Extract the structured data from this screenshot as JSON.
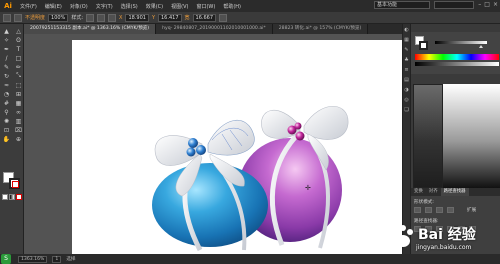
{
  "app": {
    "logo": "Ai"
  },
  "menu": {
    "items": [
      "文件(F)",
      "编辑(E)",
      "对象(O)",
      "文字(T)",
      "选择(S)",
      "效果(C)",
      "视图(V)",
      "窗口(W)",
      "帮助(H)"
    ]
  },
  "workspace": {
    "label": "基本功能"
  },
  "control": {
    "selection_label": "不透明度",
    "opacity_value": "100%",
    "style_label": "样式:",
    "x_label": "X",
    "x_value": "18.901",
    "y_label": "Y",
    "y_value": "16.417",
    "w_label": "宽",
    "w_value": "16.667"
  },
  "tabs": [
    {
      "label": "20079251153315 副本.ai* @ 1363.16% (CMYK/预览)",
      "active": true
    },
    {
      "label": "hyq- 29840807_20190001102010001000.ai*",
      "active": false
    },
    {
      "label": "28823 转化.ai* @ 157% (CMYK/预览)",
      "active": false
    }
  ],
  "tools": [
    {
      "name": "selection-tool-icon",
      "glyph": "▲"
    },
    {
      "name": "direct-selection-tool-icon",
      "glyph": "△"
    },
    {
      "name": "magic-wand-tool-icon",
      "glyph": "✧"
    },
    {
      "name": "lasso-tool-icon",
      "glyph": "ʘ"
    },
    {
      "name": "pen-tool-icon",
      "glyph": "✒"
    },
    {
      "name": "type-tool-icon",
      "glyph": "T"
    },
    {
      "name": "line-tool-icon",
      "glyph": "/"
    },
    {
      "name": "rectangle-tool-icon",
      "glyph": "□"
    },
    {
      "name": "paintbrush-tool-icon",
      "glyph": "✎"
    },
    {
      "name": "pencil-tool-icon",
      "glyph": "✏"
    },
    {
      "name": "rotate-tool-icon",
      "glyph": "↻"
    },
    {
      "name": "scale-tool-icon",
      "glyph": "⤡"
    },
    {
      "name": "warp-tool-icon",
      "glyph": "≈"
    },
    {
      "name": "free-transform-tool-icon",
      "glyph": "⬚"
    },
    {
      "name": "shape-builder-tool-icon",
      "glyph": "◔"
    },
    {
      "name": "perspective-tool-icon",
      "glyph": "⊞"
    },
    {
      "name": "mesh-tool-icon",
      "glyph": "#"
    },
    {
      "name": "gradient-tool-icon",
      "glyph": "▦"
    },
    {
      "name": "eyedropper-tool-icon",
      "glyph": "⚲"
    },
    {
      "name": "blend-tool-icon",
      "glyph": "∞"
    },
    {
      "name": "symbol-sprayer-tool-icon",
      "glyph": "✺"
    },
    {
      "name": "graph-tool-icon",
      "glyph": "▥"
    },
    {
      "name": "artboard-tool-icon",
      "glyph": "⊡"
    },
    {
      "name": "slice-tool-icon",
      "glyph": "⌧"
    },
    {
      "name": "hand-tool-icon",
      "glyph": "✋"
    },
    {
      "name": "zoom-tool-icon",
      "glyph": "⊕"
    }
  ],
  "panels": {
    "tabs": [
      {
        "label": "变换",
        "active": false
      },
      {
        "label": "对齐",
        "active": false
      },
      {
        "label": "路径查找器",
        "active": true
      }
    ],
    "shape_modes_label": "形状模式:",
    "pathfinder_label": "路径查找器:",
    "expand_label": "扩展"
  },
  "status": {
    "zoom": "1363.16%",
    "page": "1",
    "mode": "选择"
  },
  "watermark": {
    "text": "Bai 经验",
    "url": "jingyan.baidu.com"
  },
  "ime": {
    "label": "S"
  },
  "colors": {
    "blue_ornament": "#1f8ecb",
    "purple_ornament": "#a54fb9",
    "bead_blue": "#2e7fd1",
    "bead_magenta": "#c0249a"
  }
}
